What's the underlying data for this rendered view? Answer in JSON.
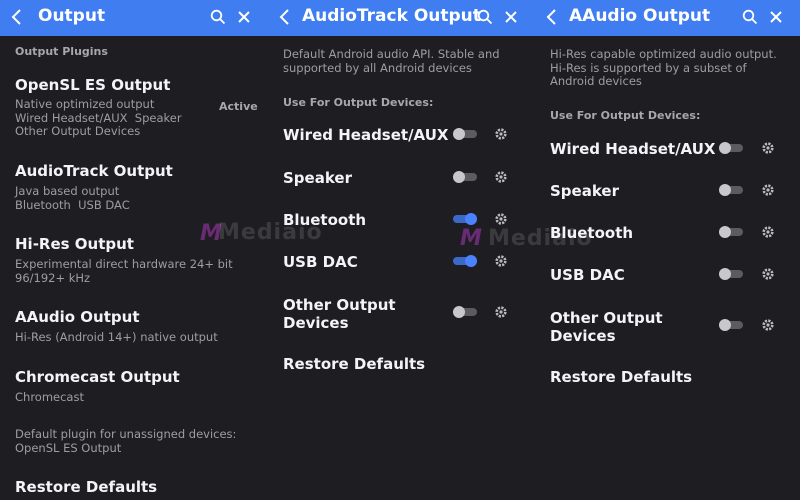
{
  "panel1": {
    "title": "Output",
    "section": "Output Plugins",
    "plugins": [
      {
        "name": "OpenSL ES Output",
        "desc": "Native optimized output\nWired Headset/AUX  Speaker\nOther Output Devices",
        "status": "Active"
      },
      {
        "name": "AudioTrack Output",
        "desc": "Java based output\nBluetooth  USB DAC"
      },
      {
        "name": "Hi-Res Output",
        "desc": "Experimental direct hardware 24+ bit\n96/192+ kHz"
      },
      {
        "name": "AAudio Output",
        "desc": "Hi-Res (Android 14+) native output"
      },
      {
        "name": "Chromecast Output",
        "desc": "Chromecast"
      }
    ],
    "default_note": "Default plugin for unassigned devices:\nOpenSL ES Output",
    "restore": "Restore Defaults"
  },
  "panel2": {
    "title": "AudioTrack Output",
    "desc": "Default Android audio API. Stable and\nsupported by all Android devices",
    "section": "Use For Output Devices:",
    "devices": [
      {
        "name": "Wired Headset/AUX",
        "enabled": false
      },
      {
        "name": "Speaker",
        "enabled": false
      },
      {
        "name": "Bluetooth",
        "enabled": true
      },
      {
        "name": "USB DAC",
        "enabled": true
      },
      {
        "name": "Other Output\nDevices",
        "enabled": false
      }
    ],
    "restore": "Restore Defaults"
  },
  "panel3": {
    "title": "AAudio Output",
    "desc": "Hi-Res capable optimized audio output.\nHi-Res is supported by a subset of\nAndroid devices",
    "section": "Use For Output Devices:",
    "devices": [
      {
        "name": "Wired Headset/AUX",
        "enabled": false
      },
      {
        "name": "Speaker",
        "enabled": false
      },
      {
        "name": "Bluetooth",
        "enabled": false
      },
      {
        "name": "USB DAC",
        "enabled": false
      },
      {
        "name": "Other Output\nDevices",
        "enabled": false
      }
    ],
    "restore": "Restore Defaults"
  },
  "watermark": "Mediaio",
  "colors": {
    "appbar": "#3f7df0",
    "background": "#1e1e22",
    "toggle_on": "#4a82ff",
    "toggle_off": "#c8c8cc"
  },
  "icons": [
    "back-arrow-icon",
    "search-icon",
    "close-icon",
    "gear-icon"
  ]
}
